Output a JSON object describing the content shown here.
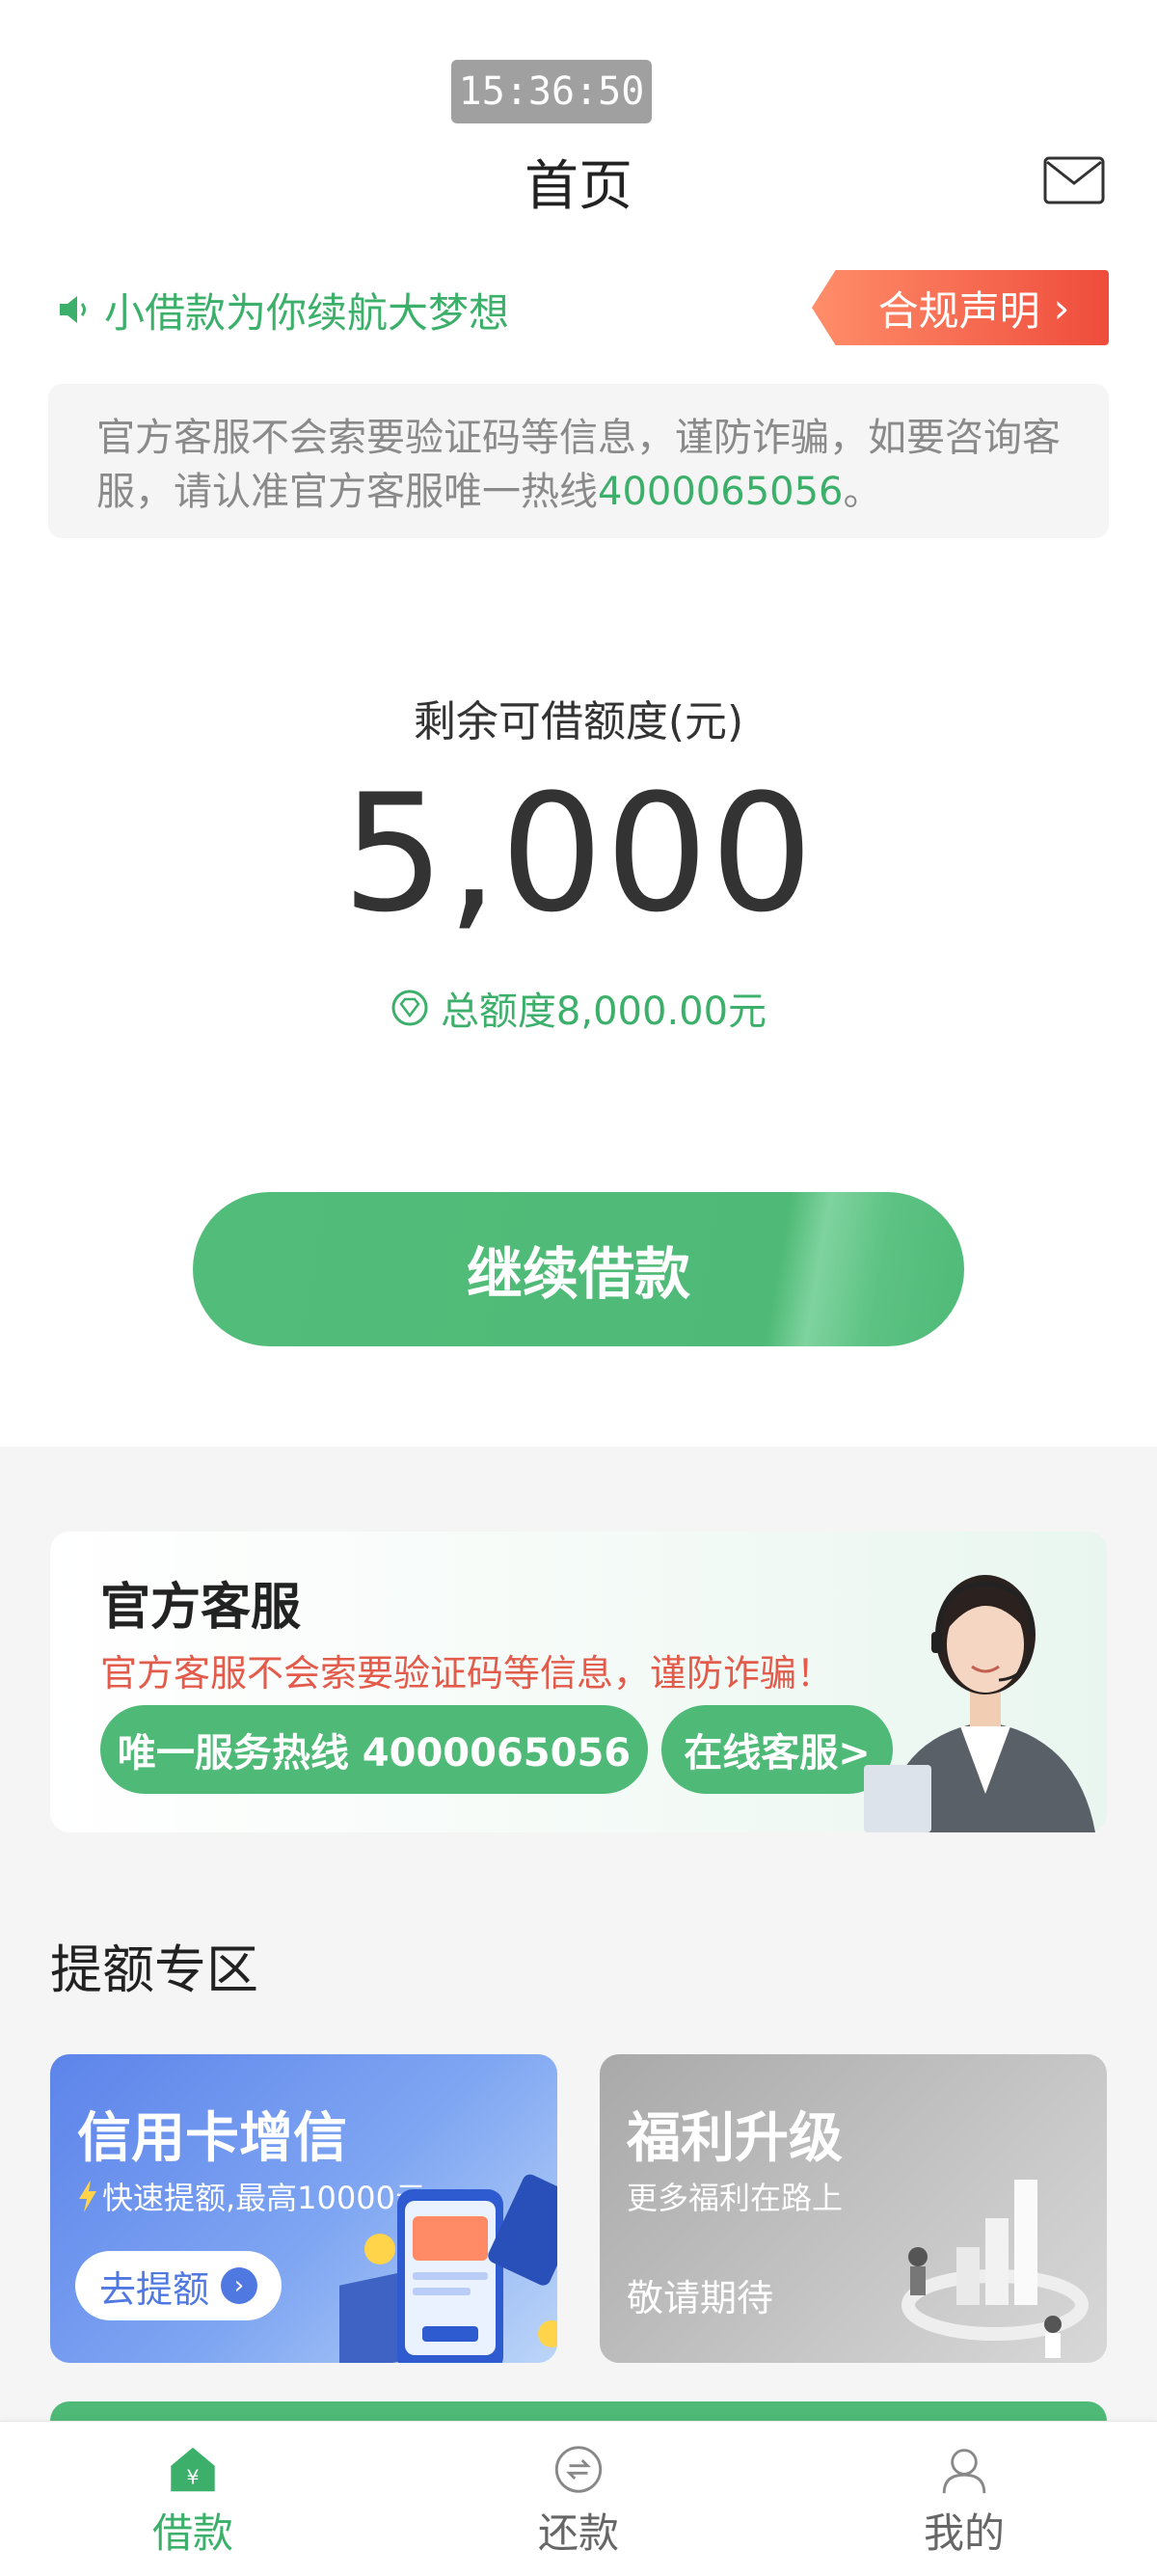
{
  "status": {
    "time": "15:36:50"
  },
  "header": {
    "title": "首页",
    "mail_icon": "mail-icon"
  },
  "notice": {
    "icon": "speaker-icon",
    "text": "小借款为你续航大梦想",
    "compliance_label": "合规声明",
    "compliance_chevron": "›"
  },
  "warning": {
    "text_before": "官方客服不会索要验证码等信息，谨防诈骗，如要咨询客服，请认准官方客服唯一热线",
    "hotline": "4000065056",
    "text_after": "。"
  },
  "quota": {
    "label": "剩余可借额度(元)",
    "value": "5,000",
    "total_icon": "diamond-icon",
    "total_text": "总额度8,000.00元"
  },
  "continue_button": {
    "label": "继续借款"
  },
  "service_card": {
    "title": "官方客服",
    "warning": "官方客服不会索要验证码等信息，谨防诈骗！",
    "hotline_button": "唯一服务热线 4000065056",
    "online_button": "在线客服>"
  },
  "zone": {
    "title": "提额专区",
    "credit_card": {
      "title": "信用卡增信",
      "subtitle": "快速提额,最高10000元",
      "button": "去提额"
    },
    "benefit_card": {
      "title": "福利升级",
      "subtitle": "更多福利在路上",
      "note": "敬请期待"
    }
  },
  "tabs": [
    {
      "label": "借款",
      "icon": "home-yuan-icon",
      "active": true
    },
    {
      "label": "还款",
      "icon": "repay-icon",
      "active": false
    },
    {
      "label": "我的",
      "icon": "profile-icon",
      "active": false
    }
  ],
  "colors": {
    "primary_green": "#4fba77",
    "accent_red": "#ef4c3c",
    "card_blue": "#5d84ea"
  }
}
